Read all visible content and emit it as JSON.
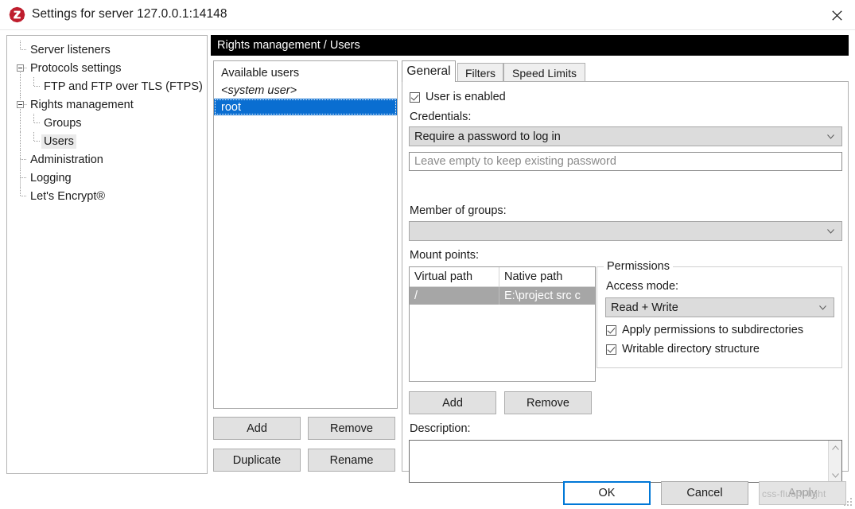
{
  "window": {
    "title": "Settings for server 127.0.0.1:14148",
    "app_icon": "filezilla-icon",
    "close_icon": "close-icon"
  },
  "sidebar": {
    "items": [
      {
        "label": "Server listeners",
        "level": 0,
        "expander": false,
        "selected": false
      },
      {
        "label": "Protocols settings",
        "level": 0,
        "expander": true,
        "selected": false
      },
      {
        "label": "FTP and FTP over TLS (FTPS)",
        "level": 1,
        "expander": false,
        "selected": false
      },
      {
        "label": "Rights management",
        "level": 0,
        "expander": true,
        "selected": false
      },
      {
        "label": "Groups",
        "level": 1,
        "expander": false,
        "selected": false
      },
      {
        "label": "Users",
        "level": 1,
        "expander": false,
        "selected": true
      },
      {
        "label": "Administration",
        "level": 0,
        "expander": false,
        "selected": false
      },
      {
        "label": "Logging",
        "level": 0,
        "expander": false,
        "selected": false
      },
      {
        "label": "Let's Encrypt®",
        "level": 0,
        "expander": false,
        "selected": false
      }
    ]
  },
  "content": {
    "header": "Rights management / Users"
  },
  "users": {
    "title": "Available users",
    "items": [
      {
        "label": "<system user>",
        "italic": true,
        "selected": false
      },
      {
        "label": "root",
        "italic": false,
        "selected": true
      }
    ],
    "buttons": {
      "add": "Add",
      "remove": "Remove",
      "duplicate": "Duplicate",
      "rename": "Rename"
    }
  },
  "detail": {
    "tabs": [
      {
        "label": "General",
        "active": true
      },
      {
        "label": "Filters",
        "active": false
      },
      {
        "label": "Speed Limits",
        "active": false
      }
    ],
    "user_enabled": {
      "label": "User is enabled",
      "checked": true
    },
    "credentials": {
      "label": "Credentials:",
      "mode_value": "Require a password to log in",
      "password_placeholder": "Leave empty to keep existing password",
      "password_value": ""
    },
    "member_of_groups": {
      "label": "Member of groups:",
      "value": ""
    },
    "mount_points": {
      "label": "Mount points:",
      "columns": [
        "Virtual path",
        "Native path"
      ],
      "rows": [
        {
          "virtual_path": "/",
          "native_path": "E:\\project src c",
          "selected": true
        }
      ],
      "buttons": {
        "add": "Add",
        "remove": "Remove"
      }
    },
    "permissions": {
      "title": "Permissions",
      "access_mode_label": "Access mode:",
      "access_mode_value": "Read + Write",
      "apply_subdirs": {
        "label": "Apply permissions to subdirectories",
        "checked": true
      },
      "writable_structure": {
        "label": "Writable directory structure",
        "checked": true
      }
    },
    "description": {
      "label": "Description:",
      "value": ""
    }
  },
  "footer": {
    "ok": "OK",
    "cancel": "Cancel",
    "apply": "Apply",
    "apply_disabled": true,
    "watermark": "css-fluent-light"
  },
  "colors": {
    "selection_blue": "#0a6ed1",
    "header_black": "#000000",
    "default_button_border": "#0078d7",
    "brand_red": "#bf1e2e"
  }
}
